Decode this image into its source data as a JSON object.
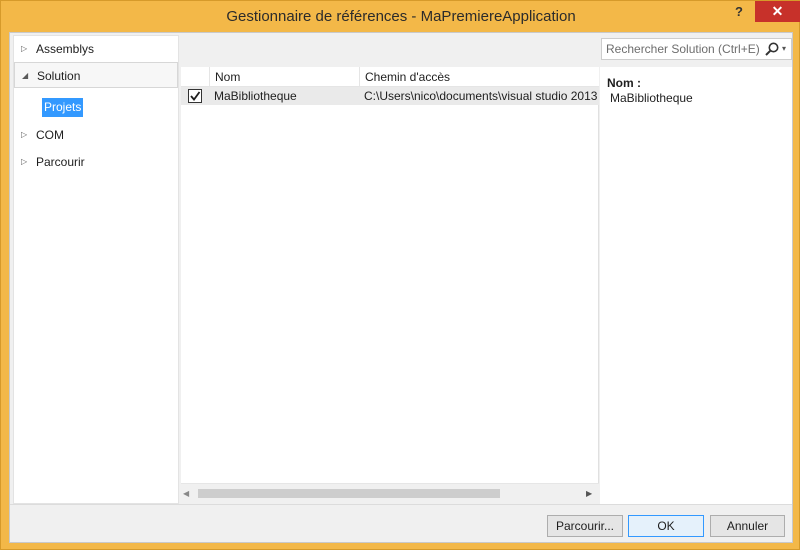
{
  "window": {
    "title": "Gestionnaire de références - MaPremiereApplication",
    "help_label": "?",
    "close_label": "✕"
  },
  "tree": {
    "items": [
      {
        "label": "Assemblys",
        "arrow": "▷"
      },
      {
        "label": "Solution",
        "arrow": "◢"
      },
      {
        "label": "COM",
        "arrow": "▷"
      },
      {
        "label": "Parcourir",
        "arrow": "▷"
      }
    ],
    "selected_child": "Projets"
  },
  "search": {
    "placeholder": "Rechercher Solution (Ctrl+E)",
    "icon": "search-icon",
    "dropdown": "▾"
  },
  "list": {
    "columns": [
      "Nom",
      "Chemin d'accès"
    ],
    "rows": [
      {
        "checked": true,
        "name": "MaBibliotheque",
        "path": "C:\\Users\\nico\\documents\\visual studio 2013"
      }
    ],
    "scroll_left": "◀",
    "scroll_right": "▶"
  },
  "details": {
    "label": "Nom :",
    "value": "MaBibliotheque"
  },
  "footer": {
    "browse_label": "Parcourir...",
    "ok_label": "OK",
    "cancel_label": "Annuler"
  }
}
